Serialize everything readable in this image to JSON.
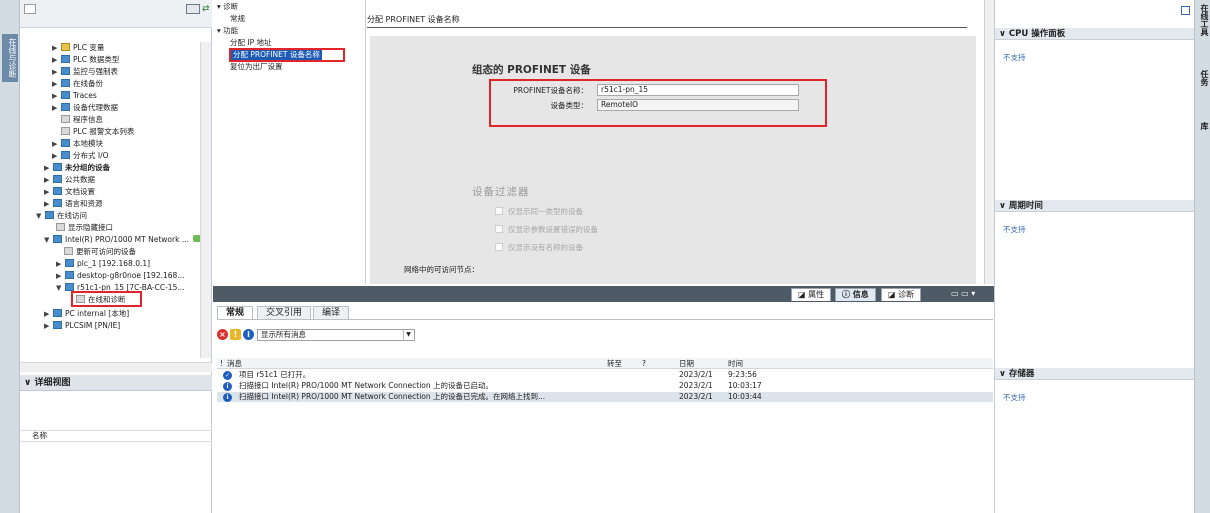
{
  "left_strip": {
    "label": "在线与诊断"
  },
  "tree": {
    "items": [
      {
        "label": "PLC 变量",
        "icon": "folder-plc-tags-icon"
      },
      {
        "label": "PLC 数据类型",
        "icon": "plc-datatype-icon"
      },
      {
        "label": "监控与强制表",
        "icon": "watch-table-icon"
      },
      {
        "label": "在线备份",
        "icon": "online-backup-icon"
      },
      {
        "label": "Traces",
        "icon": "traces-icon"
      },
      {
        "label": "设备代理数据",
        "icon": "device-proxy-icon"
      },
      {
        "label": "程序信息",
        "icon": "program-info-icon"
      },
      {
        "label": "PLC 报警文本列表",
        "icon": "alarm-text-icon"
      },
      {
        "label": "本地模块",
        "icon": "local-modules-icon"
      },
      {
        "label": "分布式 I/O",
        "icon": "distributed-io-icon"
      },
      {
        "label": "未分组的设备",
        "icon": "ungrouped-devices-icon"
      },
      {
        "label": "公共数据",
        "icon": "common-data-icon"
      },
      {
        "label": "文档设置",
        "icon": "document-settings-icon"
      },
      {
        "label": "语言和资源",
        "icon": "languages-icon"
      },
      {
        "label": "在线访问",
        "icon": "online-access-icon"
      },
      {
        "label": "显示隐藏接口",
        "icon": "show-hidden-icon"
      },
      {
        "label": "Intel(R) PRO/1000 MT Network ...",
        "icon": "network-adapter-icon"
      },
      {
        "label": "更新可访问的设备",
        "icon": "refresh-devices-icon"
      },
      {
        "label": "plc_1 [192.168.0.1]",
        "icon": "plc-icon"
      },
      {
        "label": "desktop-g8r0noe [192.168...",
        "icon": "pc-icon"
      },
      {
        "label": "r51c1-pn_15 [7C-BA-CC-15...",
        "icon": "device-icon"
      },
      {
        "label": "在线和诊断",
        "icon": "diagnostics-icon"
      },
      {
        "label": "PC internal [本地]",
        "icon": "pc-internal-icon"
      },
      {
        "label": "PLCSIM [PN/IE]",
        "icon": "plcsim-icon"
      }
    ]
  },
  "detail_view": {
    "title": "详细视图",
    "column_name": "名称"
  },
  "nav": {
    "items": [
      "诊断",
      "常规",
      "功能",
      "分配 IP 地址",
      "分配 PROFINET 设备名称",
      "复位为出厂设置"
    ],
    "selected": "分配 PROFINET 设备名称"
  },
  "main": {
    "title": "分配 PROFINET 设备名称",
    "section_configured": "组态的 PROFINET 设备",
    "device_name_label": "PROFINET设备名称：",
    "device_name_value": "r51c1-pn_15",
    "device_type_label": "设备类型：",
    "device_type_value": "RemoteIO",
    "section_filter": "设备过滤器",
    "filter_options": [
      "仅显示同一类型的设备",
      "仅显示参数设置错误的设备",
      "仅显示没有名称的设备"
    ],
    "accessible_nodes_label": "网络中的可访问节点："
  },
  "inspector_tabs": {
    "properties": "属性",
    "info": "信息",
    "diagnostics": "诊断"
  },
  "info": {
    "tabs": [
      "常规",
      "交叉引用",
      "编译"
    ],
    "filter_value": "显示所有消息",
    "columns": {
      "excl": "!",
      "message": "消息",
      "goto": "转至",
      "q": "?",
      "date": "日期",
      "time": "时间"
    },
    "messages": [
      {
        "text": "项目 r51c1 已打开。",
        "date": "2023/2/1",
        "time": "9:23:56",
        "type": "success"
      },
      {
        "text": "扫描接口 Intel(R) PRO/1000 MT Network Connection 上的设备已启动。",
        "date": "2023/2/1",
        "time": "10:03:17",
        "type": "info"
      },
      {
        "text": "扫描接口 Intel(R) PRO/1000 MT Network Connection 上的设备已完成。在网络上找到...",
        "date": "2023/2/1",
        "time": "10:03:44",
        "type": "info"
      }
    ]
  },
  "right_panel": {
    "cpu_panel_title": "CPU 操作面板",
    "cpu_panel_text": "不支持",
    "cycle_time_title": "周期时间",
    "cycle_time_text": "不支持",
    "memory_title": "存储器",
    "memory_text": "不支持"
  },
  "right_strip": {
    "tab1": "在线工具",
    "tab2": "任务",
    "tab3": "库"
  },
  "colors": {
    "highlight": "#e2252b",
    "selection": "#1e5bb5",
    "link_text": "#3b6fb0"
  }
}
